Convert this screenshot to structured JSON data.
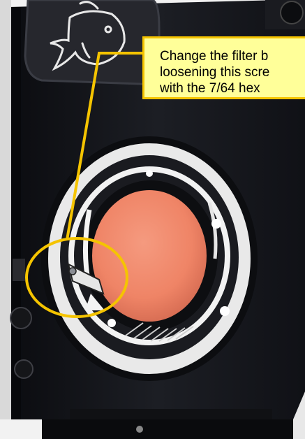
{
  "callout": {
    "lines": [
      "Change the filter b",
      "loosening this scre",
      "with the 7/64 hex"
    ]
  },
  "photo": {
    "subject": "underwater camera housing with orange color-correction filter",
    "accent_color": "#f5c400",
    "filter_color": "#f0876a",
    "highlight_icon": "ellipse-highlight"
  }
}
